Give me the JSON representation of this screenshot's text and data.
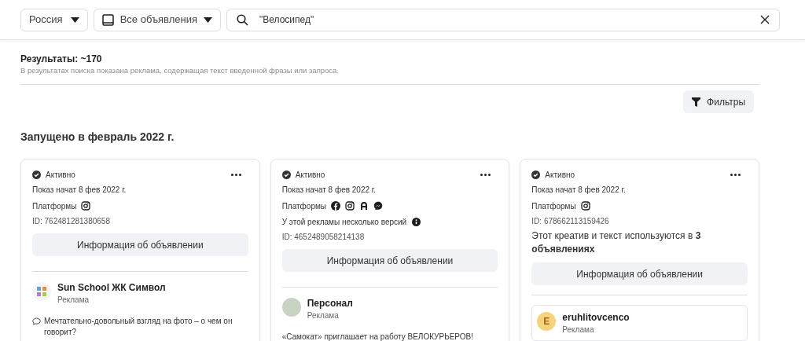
{
  "search_bar": {
    "country": "Россия",
    "ad_type": "Все объявления",
    "query": "\"Велосипед\""
  },
  "results": {
    "count": "Результаты: ~170",
    "note": "В результатах поиска показана реклама, содержащая текст введенной фразы или запроса."
  },
  "filters_button": "Фильтры",
  "section_heading": "Запущено в февраль 2022 г.",
  "cards": [
    {
      "status": "Активно",
      "started": "Показ начат 8 фев 2022 г.",
      "platforms_label": "Платформы",
      "platforms": [
        {
          "kind": "instagram"
        }
      ],
      "id": "ID: 762481281380658",
      "button": "Информация об объявлении",
      "advertiser": {
        "name": "Sun School ЖК Символ",
        "sponsored": "Реклама",
        "avatar": {
          "kind": "logo"
        }
      },
      "body": "Мечтательно-довольный взгляд на фото – о чем он говорит?",
      "boxed": false
    },
    {
      "status": "Активно",
      "started": "Показ начат 8 фев 2022 г.",
      "platforms_label": "Платформы",
      "platforms": [
        {
          "kind": "facebook"
        },
        {
          "kind": "instagram"
        },
        {
          "kind": "audience"
        },
        {
          "kind": "messenger"
        }
      ],
      "versions_note": "У этой рекламы несколько версий",
      "id": "ID: 4652489058214138",
      "button": "Информация об объявлении",
      "advertiser": {
        "name": "Персонал",
        "sponsored": "Реклама",
        "avatar": {
          "kind": "photo"
        }
      },
      "body": "«Самокат» приглашает на работу ВЕЛОКУРЬЕРОВ!",
      "boxed": false
    },
    {
      "status": "Активно",
      "started": "Показ начат 8 фев 2022 г.",
      "platforms_label": "Платформы",
      "platforms": [
        {
          "kind": "instagram"
        }
      ],
      "id": "ID: 678662113159426",
      "usage_note": "Этот креатив и текст используются в **3 объявлениях**",
      "button": "Информация об объявлении",
      "advertiser": {
        "name": "eruhlitovcenco",
        "sponsored": "Реклама",
        "avatar": {
          "kind": "letter",
          "letter": "E"
        }
      },
      "boxed": true
    }
  ]
}
